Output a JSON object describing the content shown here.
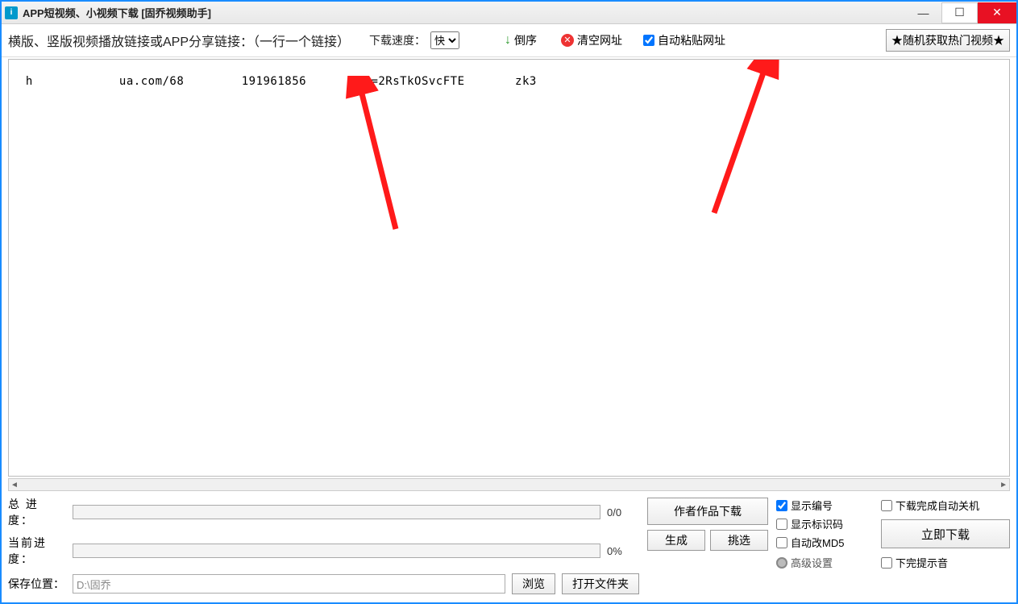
{
  "window": {
    "title": "APP短视频、小视频下载 [固乔视频助手]",
    "icon_letter": "i"
  },
  "toolbar": {
    "instruction": "横版、竖版视频播放链接或APP分享链接：（一行一个链接）",
    "speed_label": "下载速度：",
    "speed_value": "快",
    "reverse_label": "倒序",
    "clear_label": "清空网址",
    "autopaste_label": "自动粘贴网址",
    "autopaste_checked": true,
    "hot_button": "★随机获取热门视频★"
  },
  "url_input": {
    "value": "h            ua.com/68        191961856       ag=2RsTkOSvcFTE       zk3"
  },
  "progress": {
    "total_label": "总 进 度：",
    "total_text": "0/0",
    "current_label": "当前进度：",
    "current_text": "0%"
  },
  "save": {
    "label": "保存位置：",
    "path": "D:\\固乔",
    "browse": "浏览",
    "open_folder": "打开文件夹"
  },
  "mid": {
    "author_btn": "作者作品下载",
    "gen_btn": "生成",
    "pick_btn": "挑选"
  },
  "checks": {
    "show_index": "显示编号",
    "show_index_checked": true,
    "show_id": "显示标识码",
    "show_id_checked": false,
    "auto_md5": "自动改MD5",
    "auto_md5_checked": false,
    "advanced": "高级设置"
  },
  "right": {
    "auto_shutdown": "下载完成自动关机",
    "auto_shutdown_checked": false,
    "download_now": "立即下载",
    "done_sound": "下完提示音",
    "done_sound_checked": false
  }
}
